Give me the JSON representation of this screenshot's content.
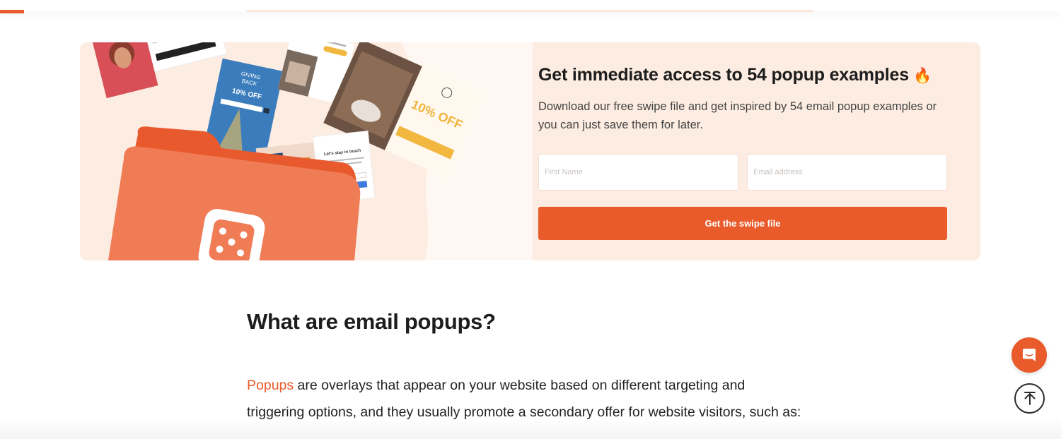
{
  "promo": {
    "title": "Get immediate access to 54 popup examples",
    "title_emoji": "🔥",
    "description": "Download our free swipe file and get inspired by 54 email popup examples or you can just save them for later.",
    "first_name_placeholder": "First Name",
    "email_placeholder": "Email address",
    "cta_label": "Get the swipe file",
    "art": {
      "card_giving_back_line1": "GIVING",
      "card_giving_back_line2": "BACK",
      "card_giving_back_offer": "10% OFF",
      "card_stay_in_touch": "Let's stay in touch",
      "card_coffee_offer": "10% OFF"
    }
  },
  "article": {
    "title": "What are email popups?",
    "link_text": "Popups",
    "body_text": " are overlays that appear on your website based on different targeting and triggering options, and they usually promote a secondary offer for website visitors, such as:"
  },
  "widgets": {
    "chat_icon": "chat-bubble-icon",
    "scroll_top_icon": "arrow-up-icon"
  },
  "colors": {
    "accent": "#ea5b2b",
    "banner_bg": "#fdece1",
    "folder": "#ee6e44",
    "button_text": "#ffffff"
  }
}
